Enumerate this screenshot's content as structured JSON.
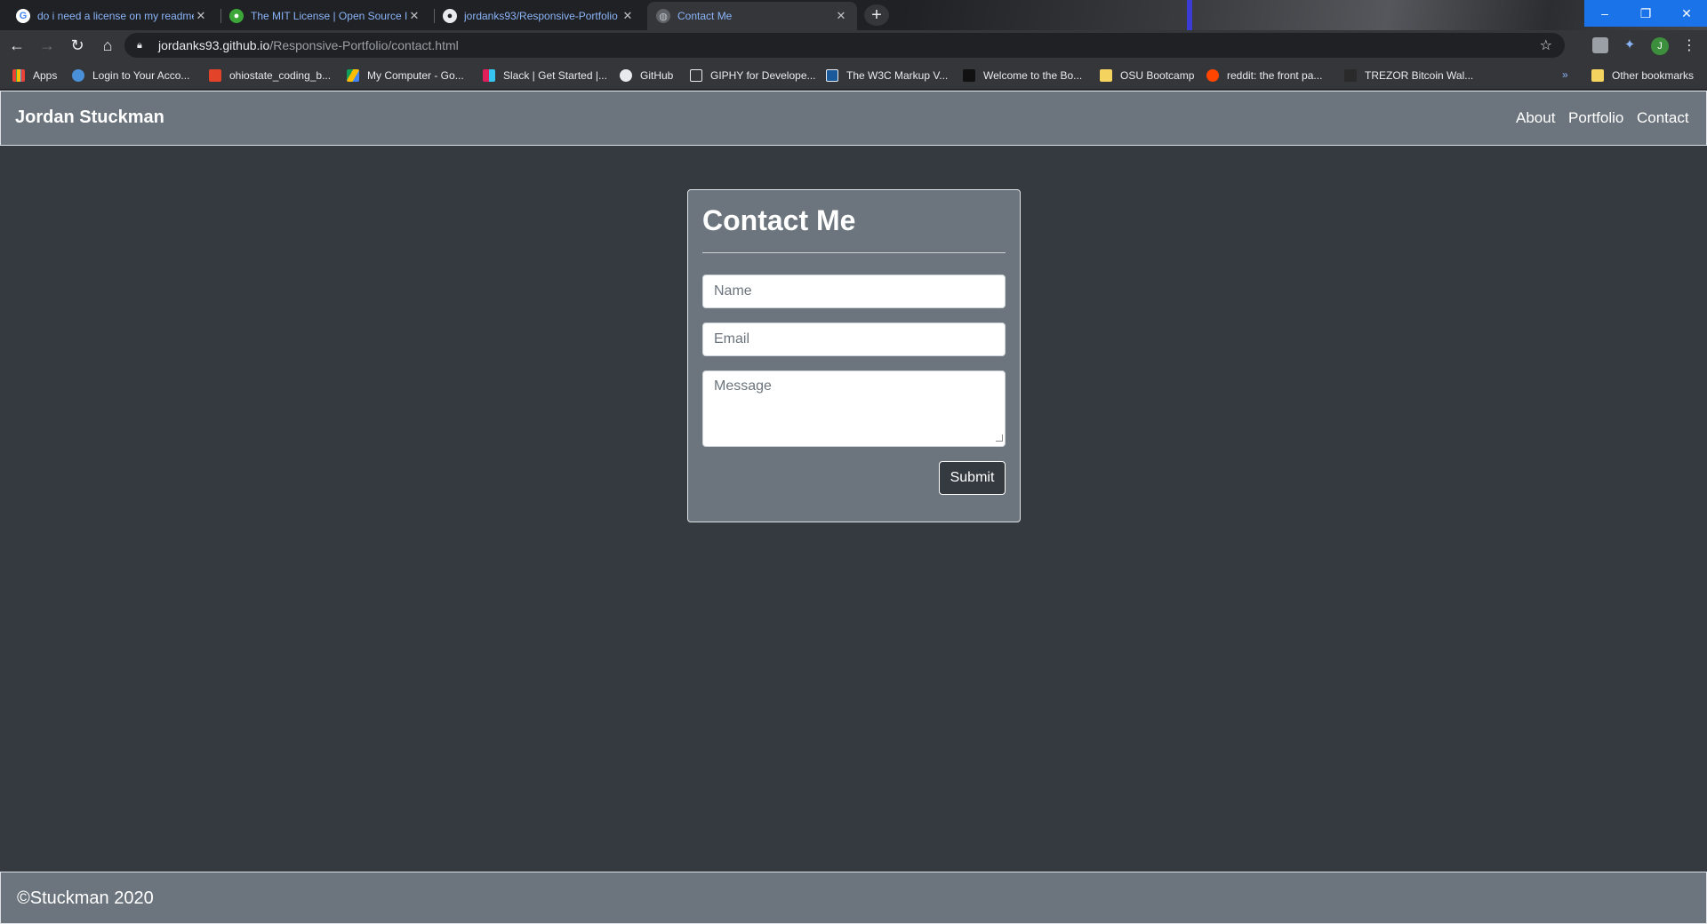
{
  "browser": {
    "tabs": [
      {
        "title": "do i need a license on my readme",
        "favicon": "google-icon",
        "active": false
      },
      {
        "title": "The MIT License | Open Source Initiative",
        "favicon": "opensource-icon",
        "active": false
      },
      {
        "title": "jordanks93/Responsive-Portfolio",
        "favicon": "github-icon",
        "active": false
      },
      {
        "title": "Contact Me",
        "favicon": "globe-icon",
        "active": true
      }
    ],
    "new_tab_symbol": "+",
    "url_host": "jordanks93.github.io",
    "url_path": "/Responsive-Portfolio/contact.html",
    "profile_initial": "J",
    "bookmarks": [
      {
        "label": "Apps",
        "icon": "apps-grid-icon",
        "color": "#ea4335"
      },
      {
        "label": "Login to Your Acco...",
        "icon": "globe-icon",
        "color": "#4a90d9"
      },
      {
        "label": "ohiostate_coding_b...",
        "icon": "gitlab-icon",
        "color": "#e24329"
      },
      {
        "label": "My Computer - Go...",
        "icon": "google-drive-icon",
        "color": "#fbbc04"
      },
      {
        "label": "Slack | Get Started |...",
        "icon": "slack-icon",
        "color": "#e01e5a"
      },
      {
        "label": "GitHub",
        "icon": "github-icon",
        "color": "#e8eaed"
      },
      {
        "label": "GIPHY for Develope...",
        "icon": "document-icon",
        "color": "#e8eaed"
      },
      {
        "label": "The W3C Markup V...",
        "icon": "w3c-icon",
        "color": "#1a5a9a"
      },
      {
        "label": "Welcome to the Bo...",
        "icon": "site-icon",
        "color": "#111111"
      },
      {
        "label": "OSU Bootcamp",
        "icon": "folder-icon",
        "color": "#f4d35e"
      },
      {
        "label": "reddit: the front pa...",
        "icon": "reddit-icon",
        "color": "#ff4500"
      },
      {
        "label": "TREZOR Bitcoin Wal...",
        "icon": "lock-icon",
        "color": "#2a2a2a"
      }
    ],
    "more_bookmarks": "»",
    "other_bookmarks": "Other bookmarks"
  },
  "site": {
    "brand": "Jordan Stuckman",
    "nav": [
      "About",
      "Portfolio",
      "Contact"
    ],
    "colors": {
      "background": "#343a40",
      "panel": "#6c757d",
      "border": "#dee2e6"
    }
  },
  "contact_form": {
    "title": "Contact Me",
    "name_placeholder": "Name",
    "email_placeholder": "Email",
    "message_placeholder": "Message",
    "submit_label": "Submit"
  },
  "footer": {
    "text": "©Stuckman 2020"
  }
}
